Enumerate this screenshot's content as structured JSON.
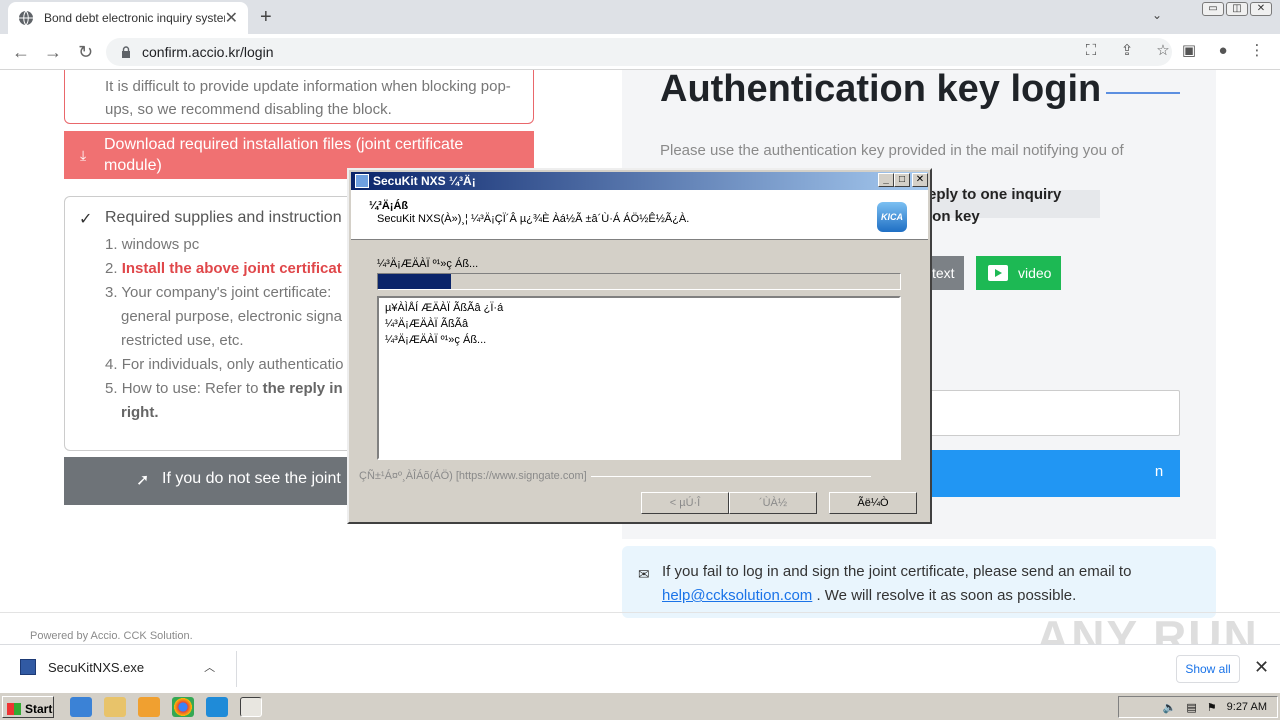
{
  "browser": {
    "tab_title": "Bond debt electronic inquiry system",
    "tab_close": "✕",
    "new_tab": "+",
    "url": "confirm.accio.kr/login",
    "win_min": "▭",
    "win_max": "◫",
    "win_close": "✕"
  },
  "page": {
    "notice_text": "It is difficult to provide update information when blocking pop-ups, so we recommend disabling the block.",
    "download_button": "Download required installation files (joint certificate module)",
    "required_heading": "Required supplies and instruction",
    "required_items": [
      {
        "num": "1.",
        "text": "windows pc"
      },
      {
        "num": "2.",
        "text": "Install the above joint certificat"
      },
      {
        "num": "3.",
        "text": "Your company's joint certificate:"
      },
      {
        "num": "",
        "text": "general purpose, electronic signa"
      },
      {
        "num": "",
        "text": "restricted use, etc."
      },
      {
        "num": "4.",
        "text": "For individuals, only authenticatio"
      },
      {
        "num": "5.",
        "text": "How to use: Refer to "
      },
      {
        "num": "",
        "text": "right."
      }
    ],
    "item5_bold": "the reply in",
    "gray_button": "If you do not see the joint",
    "auth_title": "Authentication key login",
    "auth_subtitle": "Please use the authentication key provided in the mail notifying you of",
    "inquiry_line1": "eply to one inquiry",
    "inquiry_line2": "ion key",
    "text_button": "text",
    "video_button": "video",
    "login_button": "n",
    "help_text_before": "If you fail to log in and sign the joint certificate, please send an email to",
    "help_email": "help@ccksolution.com",
    "help_text_after": " . We will resolve it as soon as possible.",
    "powered_by": "Powered by Accio. CCK Solution."
  },
  "watermark": "ANY RUN",
  "downloads": {
    "file_name": "SecuKitNXS.exe",
    "show_all": "Show all",
    "close": "✕"
  },
  "taskbar": {
    "start_label": "Start",
    "clock": "9:27 AM"
  },
  "dialog": {
    "title": "SecuKit NXS ¼³Ä¡",
    "header_title": "¼³Ä¡Áß",
    "header_desc": "SecuKit NXS(À»)¸¦ ¼³Ä¡ÇÏ´Â µ¿¾È Àá½Ã ±â´Ù·Á ÁÖ½Ê½Ã¿À.",
    "status": "¼³Ä¡ÆÄÀÏ º¹»ç Áß...",
    "progress_fraction": 0.14,
    "log_lines": [
      "µ¥ÀÌÅÍ ÆÄÀÏ ÃßÃâ ¿Ï·á",
      "¼³Ä¡ÆÄÀÏ ÃßÃâ",
      "¼³Ä¡ÆÄÀÏ º¹»ç Áß..."
    ],
    "brand_text": "ÇÑ±¹Á¤º¸ÀÎÁõ(ÁÖ) [https://www.signgate.com]",
    "back_button": "< µÚ·Î",
    "next_button": "´ÙÀ½",
    "cancel_button": "Ãë¼Ò",
    "kica_logo": "KICA"
  },
  "colors": {
    "download_bar": "#f07172",
    "login_blue": "#2196f3",
    "video_green": "#1db954",
    "dialog_title_start": "#0a246a"
  }
}
